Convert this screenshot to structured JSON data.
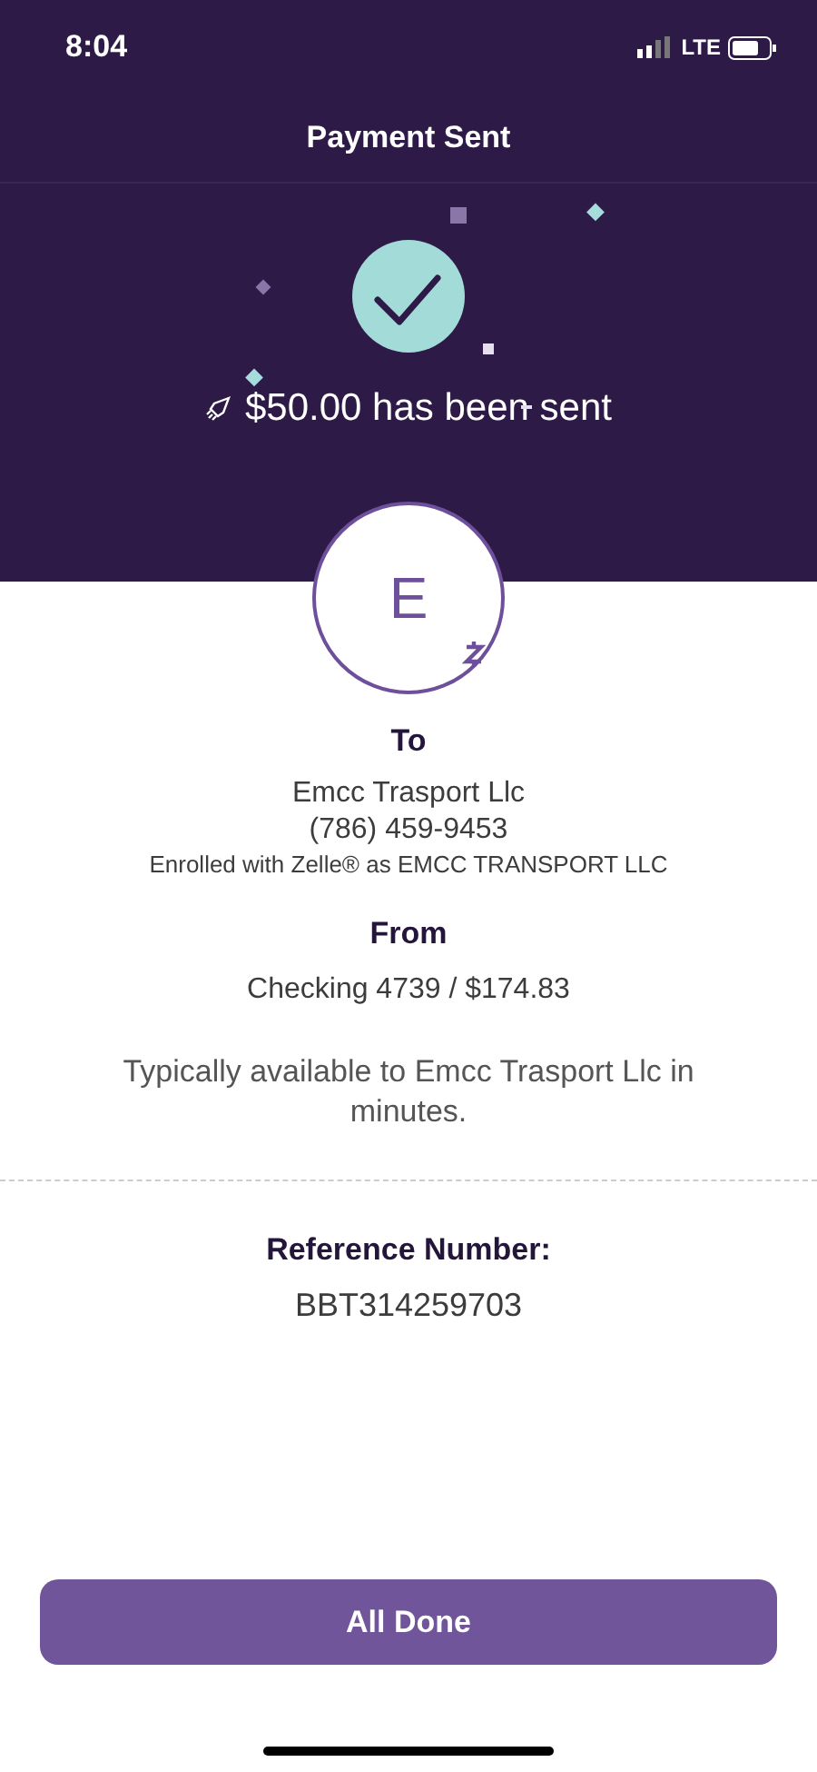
{
  "status_bar": {
    "time": "8:04",
    "network": "LTE"
  },
  "header": {
    "title": "Payment Sent",
    "amount_message": "$50.00 has been sent"
  },
  "recipient": {
    "initial": "E",
    "heading": "To",
    "name": "Emcc Trasport Llc",
    "phone": "(786) 459-9453",
    "enrollment": "Enrolled with Zelle® as EMCC TRANSPORT LLC"
  },
  "source": {
    "heading": "From",
    "account": "Checking 4739 / $174.83"
  },
  "availability": "Typically available to Emcc Trasport Llc in minutes.",
  "reference": {
    "heading": "Reference Number:",
    "value": "BBT314259703"
  },
  "primary_button": "All Done"
}
